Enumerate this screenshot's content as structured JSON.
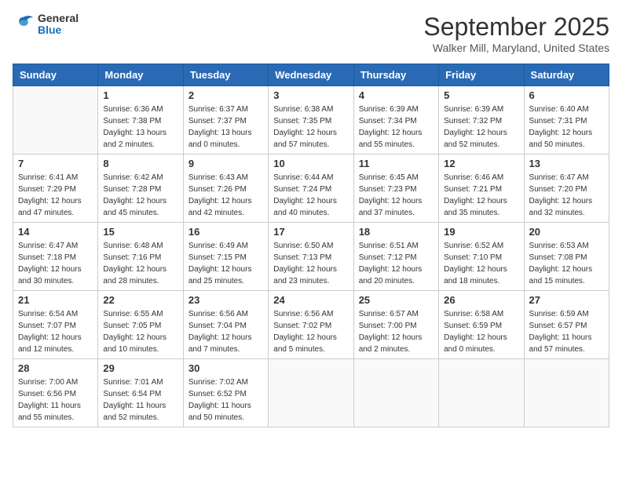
{
  "header": {
    "logo_general": "General",
    "logo_blue": "Blue",
    "month": "September 2025",
    "location": "Walker Mill, Maryland, United States"
  },
  "days_of_week": [
    "Sunday",
    "Monday",
    "Tuesday",
    "Wednesday",
    "Thursday",
    "Friday",
    "Saturday"
  ],
  "weeks": [
    [
      {
        "day": "",
        "info": ""
      },
      {
        "day": "1",
        "info": "Sunrise: 6:36 AM\nSunset: 7:38 PM\nDaylight: 13 hours\nand 2 minutes."
      },
      {
        "day": "2",
        "info": "Sunrise: 6:37 AM\nSunset: 7:37 PM\nDaylight: 13 hours\nand 0 minutes."
      },
      {
        "day": "3",
        "info": "Sunrise: 6:38 AM\nSunset: 7:35 PM\nDaylight: 12 hours\nand 57 minutes."
      },
      {
        "day": "4",
        "info": "Sunrise: 6:39 AM\nSunset: 7:34 PM\nDaylight: 12 hours\nand 55 minutes."
      },
      {
        "day": "5",
        "info": "Sunrise: 6:39 AM\nSunset: 7:32 PM\nDaylight: 12 hours\nand 52 minutes."
      },
      {
        "day": "6",
        "info": "Sunrise: 6:40 AM\nSunset: 7:31 PM\nDaylight: 12 hours\nand 50 minutes."
      }
    ],
    [
      {
        "day": "7",
        "info": "Sunrise: 6:41 AM\nSunset: 7:29 PM\nDaylight: 12 hours\nand 47 minutes."
      },
      {
        "day": "8",
        "info": "Sunrise: 6:42 AM\nSunset: 7:28 PM\nDaylight: 12 hours\nand 45 minutes."
      },
      {
        "day": "9",
        "info": "Sunrise: 6:43 AM\nSunset: 7:26 PM\nDaylight: 12 hours\nand 42 minutes."
      },
      {
        "day": "10",
        "info": "Sunrise: 6:44 AM\nSunset: 7:24 PM\nDaylight: 12 hours\nand 40 minutes."
      },
      {
        "day": "11",
        "info": "Sunrise: 6:45 AM\nSunset: 7:23 PM\nDaylight: 12 hours\nand 37 minutes."
      },
      {
        "day": "12",
        "info": "Sunrise: 6:46 AM\nSunset: 7:21 PM\nDaylight: 12 hours\nand 35 minutes."
      },
      {
        "day": "13",
        "info": "Sunrise: 6:47 AM\nSunset: 7:20 PM\nDaylight: 12 hours\nand 32 minutes."
      }
    ],
    [
      {
        "day": "14",
        "info": "Sunrise: 6:47 AM\nSunset: 7:18 PM\nDaylight: 12 hours\nand 30 minutes."
      },
      {
        "day": "15",
        "info": "Sunrise: 6:48 AM\nSunset: 7:16 PM\nDaylight: 12 hours\nand 28 minutes."
      },
      {
        "day": "16",
        "info": "Sunrise: 6:49 AM\nSunset: 7:15 PM\nDaylight: 12 hours\nand 25 minutes."
      },
      {
        "day": "17",
        "info": "Sunrise: 6:50 AM\nSunset: 7:13 PM\nDaylight: 12 hours\nand 23 minutes."
      },
      {
        "day": "18",
        "info": "Sunrise: 6:51 AM\nSunset: 7:12 PM\nDaylight: 12 hours\nand 20 minutes."
      },
      {
        "day": "19",
        "info": "Sunrise: 6:52 AM\nSunset: 7:10 PM\nDaylight: 12 hours\nand 18 minutes."
      },
      {
        "day": "20",
        "info": "Sunrise: 6:53 AM\nSunset: 7:08 PM\nDaylight: 12 hours\nand 15 minutes."
      }
    ],
    [
      {
        "day": "21",
        "info": "Sunrise: 6:54 AM\nSunset: 7:07 PM\nDaylight: 12 hours\nand 12 minutes."
      },
      {
        "day": "22",
        "info": "Sunrise: 6:55 AM\nSunset: 7:05 PM\nDaylight: 12 hours\nand 10 minutes."
      },
      {
        "day": "23",
        "info": "Sunrise: 6:56 AM\nSunset: 7:04 PM\nDaylight: 12 hours\nand 7 minutes."
      },
      {
        "day": "24",
        "info": "Sunrise: 6:56 AM\nSunset: 7:02 PM\nDaylight: 12 hours\nand 5 minutes."
      },
      {
        "day": "25",
        "info": "Sunrise: 6:57 AM\nSunset: 7:00 PM\nDaylight: 12 hours\nand 2 minutes."
      },
      {
        "day": "26",
        "info": "Sunrise: 6:58 AM\nSunset: 6:59 PM\nDaylight: 12 hours\nand 0 minutes."
      },
      {
        "day": "27",
        "info": "Sunrise: 6:59 AM\nSunset: 6:57 PM\nDaylight: 11 hours\nand 57 minutes."
      }
    ],
    [
      {
        "day": "28",
        "info": "Sunrise: 7:00 AM\nSunset: 6:56 PM\nDaylight: 11 hours\nand 55 minutes."
      },
      {
        "day": "29",
        "info": "Sunrise: 7:01 AM\nSunset: 6:54 PM\nDaylight: 11 hours\nand 52 minutes."
      },
      {
        "day": "30",
        "info": "Sunrise: 7:02 AM\nSunset: 6:52 PM\nDaylight: 11 hours\nand 50 minutes."
      },
      {
        "day": "",
        "info": ""
      },
      {
        "day": "",
        "info": ""
      },
      {
        "day": "",
        "info": ""
      },
      {
        "day": "",
        "info": ""
      }
    ]
  ]
}
